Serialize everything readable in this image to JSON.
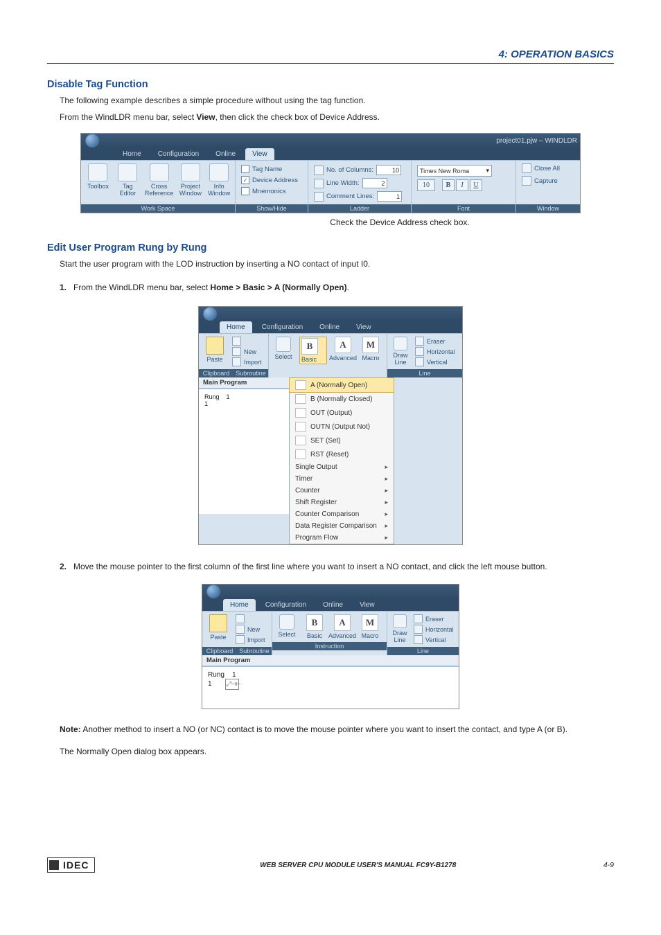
{
  "page": {
    "header_right": "4: OPERATION BASICS",
    "footer_center": "WEB SERVER CPU MODULE USER'S MANUAL  FC9Y-B1278",
    "footer_page": "4-9",
    "idec": "IDEC"
  },
  "section1": {
    "title": "Disable Tag Function",
    "p1": "The following example describes a simple procedure without using the tag function.",
    "p2_a": "From the WindLDR menu bar, select ",
    "p2_b_bold": "View",
    "p2_c": ", then click the check box of Device Address.",
    "caption": "Check the Device Address check box."
  },
  "shot1": {
    "title_right": "project01.pjw – WINDLDR",
    "tabs": {
      "home": "Home",
      "config": "Configuration",
      "online": "Online",
      "view": "View"
    },
    "workspace": {
      "toolbox": "Toolbox",
      "tag_editor_1": "Tag",
      "tag_editor_2": "Editor",
      "cross_1": "Cross",
      "cross_2": "Reference",
      "project_1": "Project",
      "project_2": "Window",
      "info_1": "Info",
      "info_2": "Window",
      "footer": "Work Space"
    },
    "showhide": {
      "tagname": "Tag Name",
      "devaddr": "Device Address",
      "mnem": "Mnemonics",
      "footer": "Show/Hide"
    },
    "ladder": {
      "cols_label": "No. of Columns:",
      "cols_val": "10",
      "lw_label": "Line Width:",
      "lw_val": "2",
      "cl_label": "Comment Lines:",
      "cl_val": "1",
      "footer": "Ladder"
    },
    "font": {
      "name": "Times New Roma",
      "size": "10",
      "b": "B",
      "i": "I",
      "u": "U",
      "footer": "Font"
    },
    "window": {
      "closeall": "Close All",
      "capture": "Capture",
      "footer": "Window"
    }
  },
  "section2": {
    "title": "Edit User Program Rung by Rung",
    "p1": "Start the user program with the LOD instruction by inserting a NO contact of input I0.",
    "step1_a": "From the WindLDR menu bar, select ",
    "step1_bold": "Home > Basic > A (Normally Open)",
    "step1_c": ".",
    "step2": "Move the mouse pointer to the first column of the first line where you want to insert a NO contact, and click the left mouse button.",
    "note_label": "Note:",
    "note_text": " Another method to insert a NO (or NC) contact is to move the mouse pointer where you want to insert the contact, and type A (or B).",
    "p_last": "The Normally Open dialog box appears."
  },
  "shot2": {
    "tabs": {
      "home": "Home",
      "config": "Configuration",
      "online": "Online",
      "view": "View"
    },
    "clipboard": {
      "paste": "Paste",
      "new": "New",
      "import": "Import",
      "footer": "Clipboard"
    },
    "subroutine": {
      "footer": "Subroutine"
    },
    "instruction": {
      "select": "Select",
      "basic": "Basic",
      "advanced": "Advanced",
      "macro": "Macro",
      "b": "B",
      "a": "A",
      "m": "M"
    },
    "line": {
      "draw1": "Draw",
      "draw2": "Line",
      "eraser": "Eraser",
      "horiz": "Horizontal",
      "vert": "Vertical",
      "footer": "Line"
    },
    "left": {
      "main": "Main Program",
      "rung": "Rung",
      "one": "1",
      "one2": "1"
    },
    "menu": {
      "a_open": "A (Normally Open)",
      "b_closed": "B (Normally Closed)",
      "out": "OUT (Output)",
      "outn": "OUTN (Output Not)",
      "set": "SET (Set)",
      "rst": "RST (Reset)",
      "single": "Single Output",
      "timer": "Timer",
      "counter": "Counter",
      "shift": "Shift Register",
      "ccmp": "Counter Comparison",
      "drcmp": "Data Register Comparison",
      "pflow": "Program Flow"
    }
  },
  "shot3": {
    "tabs": {
      "home": "Home",
      "config": "Configuration",
      "online": "Online",
      "view": "View"
    },
    "clipboard": {
      "paste": "Paste",
      "new": "New",
      "import": "Import",
      "footer": "Clipboard"
    },
    "subroutine": {
      "footer": "Subroutine"
    },
    "instruction": {
      "select": "Select",
      "basic": "Basic",
      "advanced": "Advanced",
      "macro": "Macro",
      "b": "B",
      "a": "A",
      "m": "M",
      "footer": "Instruction"
    },
    "line": {
      "draw1": "Draw",
      "draw2": "Line",
      "eraser": "Eraser",
      "horiz": "Horizontal",
      "vert": "Vertical",
      "footer": "Line"
    },
    "left": {
      "main": "Main Program",
      "rung": "Rung",
      "one": "1",
      "one2": "1"
    }
  }
}
